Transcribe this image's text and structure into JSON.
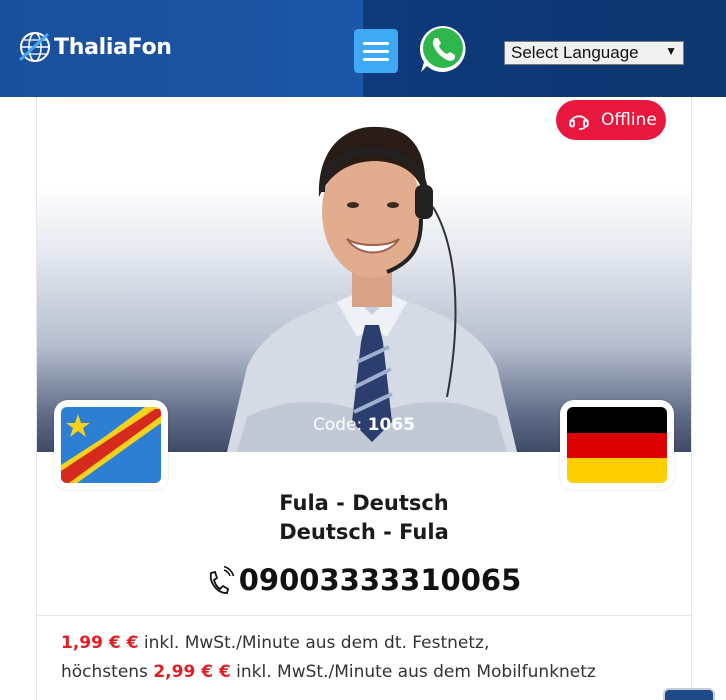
{
  "header": {
    "logo_text": "ThaliaFon",
    "menu_icon": "hamburger-icon",
    "whatsapp_icon": "whatsapp-icon",
    "language_select": "Select Language"
  },
  "status": {
    "label": "Offline",
    "icon": "headset-icon",
    "color": "#e8173e"
  },
  "code": {
    "label": "Code:",
    "value": "1065"
  },
  "languages": {
    "line1": "Fula - Deutsch",
    "line2": "Deutsch - Fula",
    "flag_left": "flag-dr-congo",
    "flag_right": "flag-germany"
  },
  "phone": {
    "icon": "phone-ringing-icon",
    "number": "09003333310065"
  },
  "pricing": {
    "line1_price": "1,99 € €",
    "line1_text": " inkl. MwSt./Minute aus dem dt. Festnetz,",
    "line2_prefix": "höchstens ",
    "line2_price": "2,99 € €",
    "line2_text": " inkl. MwSt./Minute aus dem Mobilfunknetz"
  },
  "colors": {
    "header_blue": "#1a4f9c",
    "menu_button": "#3fa9f5",
    "price_red": "#e31d24"
  }
}
